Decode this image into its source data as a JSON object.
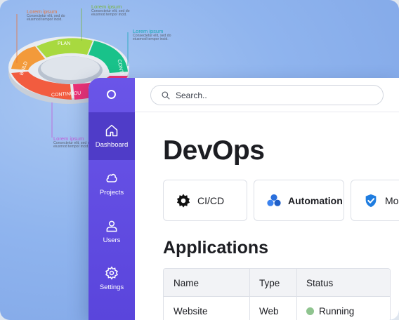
{
  "diagram": {
    "segments": [
      "PLAN",
      "CONTI",
      "CONTINUOU",
      "BUILD"
    ],
    "notes": [
      {
        "title": "Lorem ipsum",
        "desc": "Consectetur elit, sed do\neiusmod tempor incid.",
        "color": "#e8743a"
      },
      {
        "title": "Lorem ipsum",
        "desc": "Consectetur elit, sed do\neiusmod tempor incid.",
        "color": "#79b33b"
      },
      {
        "title": "Lorem ipsum",
        "desc": "Consectetur elit, sed do\neiusmod tempor incid.",
        "color": "#1aa7b8"
      },
      {
        "title": "Lorem ipsum",
        "desc": "Consectetur elit, sed do\neiusmod tempor incid.",
        "color": "#c15ad8"
      }
    ]
  },
  "sidebar": {
    "logo_icon": "circle-logo-icon",
    "items": [
      {
        "label": "Dashboard",
        "icon": "home-icon",
        "active": true
      },
      {
        "label": "Projects",
        "icon": "cloud-icon",
        "active": false
      },
      {
        "label": "Users",
        "icon": "user-icon",
        "active": false
      },
      {
        "label": "Settings",
        "icon": "gear-icon",
        "active": false
      }
    ]
  },
  "search": {
    "placeholder": "Search..",
    "icon": "search-icon"
  },
  "page": {
    "title": "DevOps"
  },
  "cards": [
    {
      "label": "CI/CD",
      "icon": "gear-icon"
    },
    {
      "label": "Automation",
      "icon": "blobs-icon"
    },
    {
      "label": "Mo",
      "icon": "shield-check-icon"
    }
  ],
  "applications": {
    "title": "Applications",
    "columns": [
      "Name",
      "Type",
      "Status"
    ],
    "rows": [
      {
        "name": "Website",
        "type": "Web",
        "status": "Running",
        "status_color": "#8fc48f"
      }
    ]
  },
  "colors": {
    "sidebar": "#6a55e8",
    "sidebar_active": "#4f3cc8",
    "accent_blue": "#1f7de0"
  }
}
